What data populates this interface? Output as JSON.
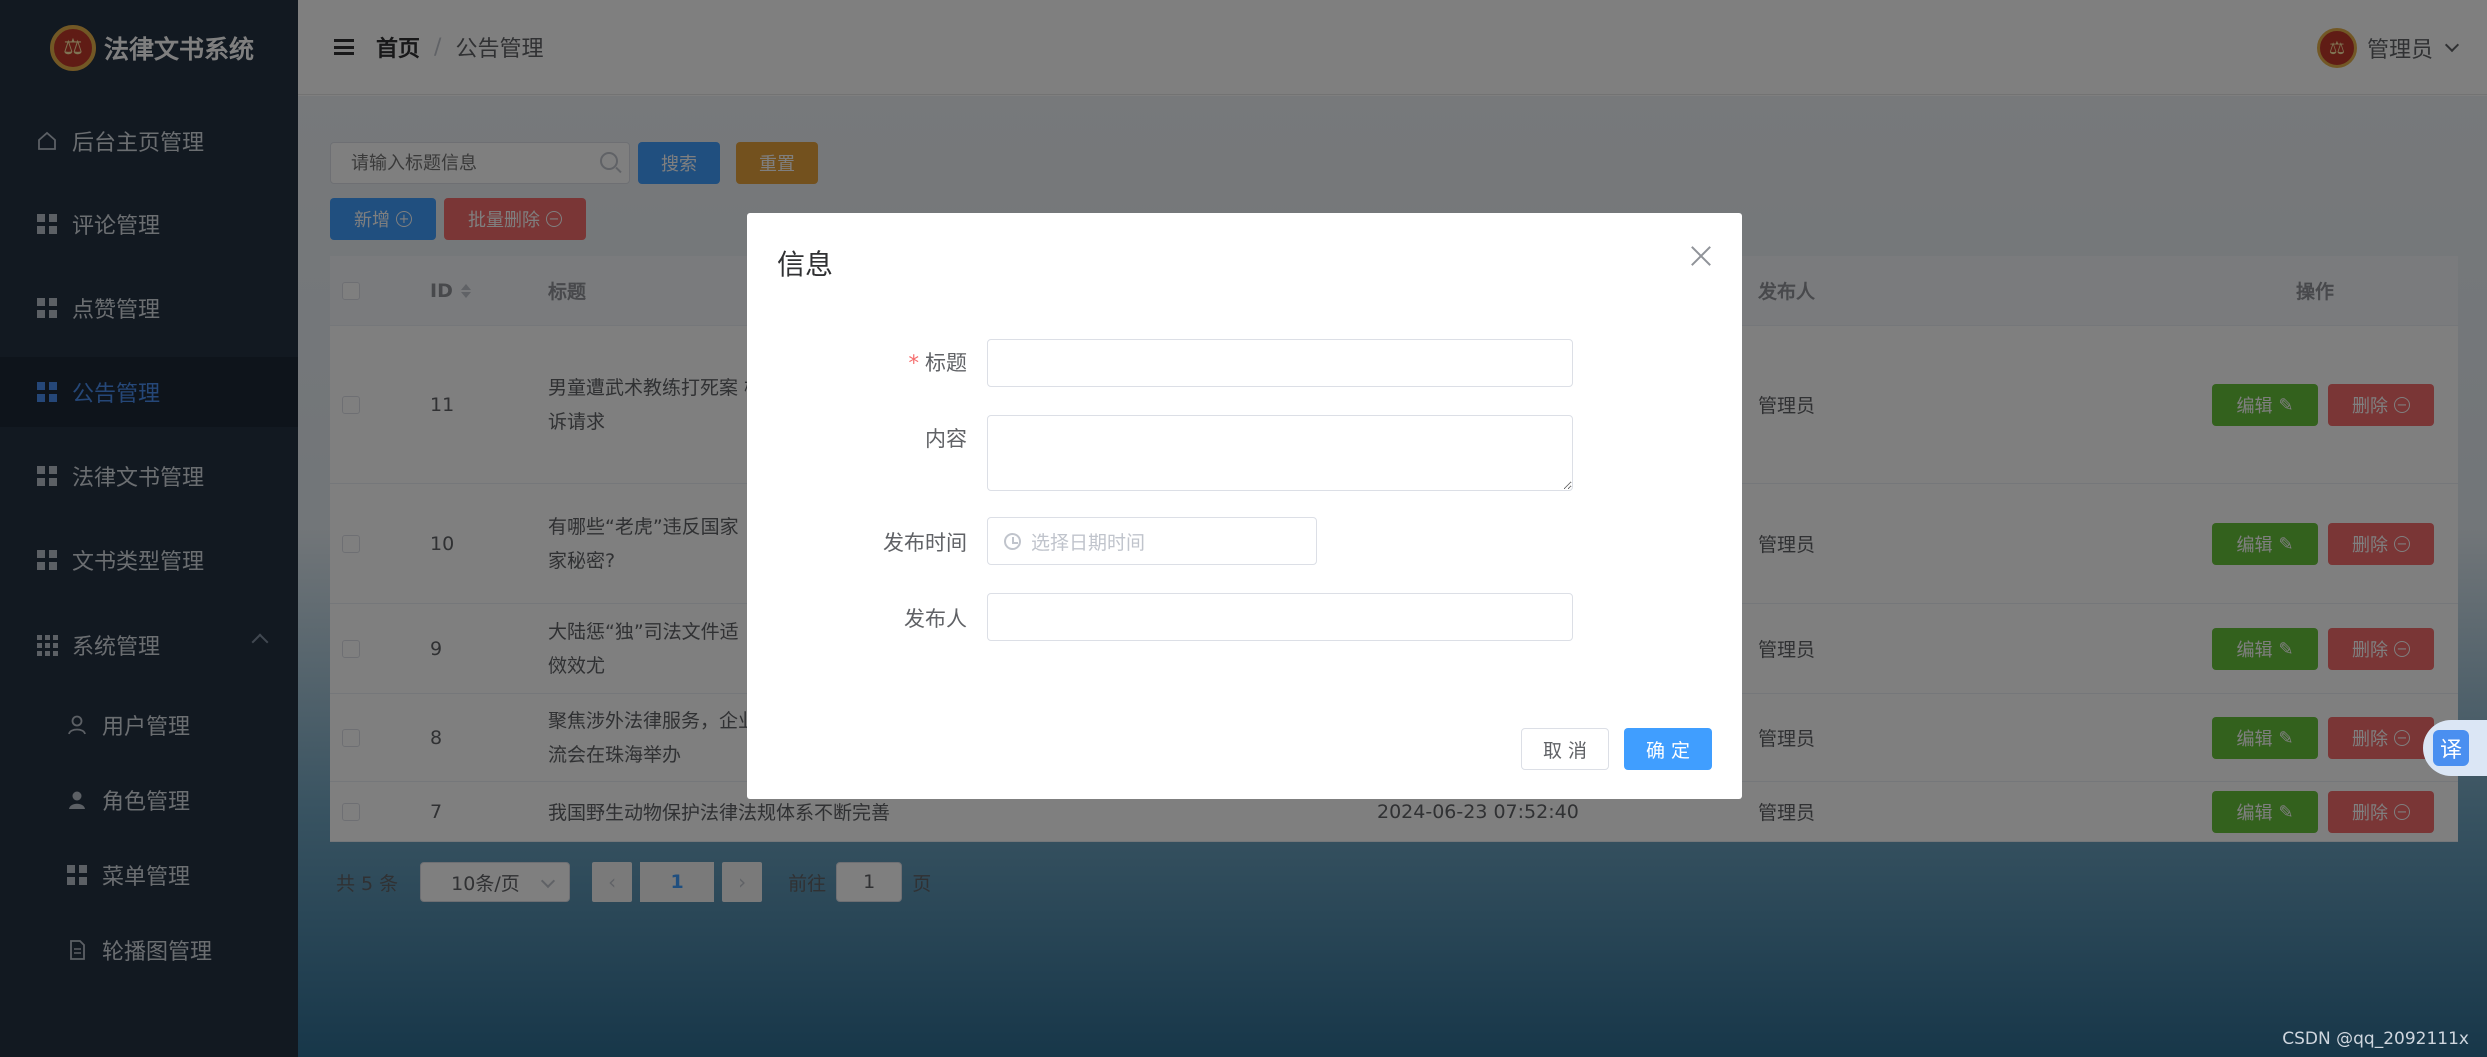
{
  "app": {
    "title": "法律文书系统"
  },
  "sidebar": {
    "items": [
      {
        "label": "后台主页管理",
        "icon": "home-icon"
      },
      {
        "label": "评论管理",
        "icon": "grid-icon"
      },
      {
        "label": "点赞管理",
        "icon": "grid-icon"
      },
      {
        "label": "公告管理",
        "icon": "grid-icon",
        "active": true
      },
      {
        "label": "法律文书管理",
        "icon": "grid-icon"
      },
      {
        "label": "文书类型管理",
        "icon": "grid-icon"
      },
      {
        "label": "系统管理",
        "icon": "apps-icon",
        "expanded": true
      }
    ],
    "sub_items": [
      {
        "label": "用户管理",
        "icon": "user-outline-icon"
      },
      {
        "label": "角色管理",
        "icon": "user-icon"
      },
      {
        "label": "菜单管理",
        "icon": "grid-icon"
      },
      {
        "label": "轮播图管理",
        "icon": "document-icon"
      }
    ]
  },
  "header": {
    "breadcrumb_home": "首页",
    "breadcrumb_sep": "/",
    "breadcrumb_current": "公告管理",
    "user": "管理员"
  },
  "toolbar": {
    "search_placeholder": "请输入标题信息",
    "search_label": "搜索",
    "reset_label": "重置",
    "add_label": "新增",
    "batch_delete_label": "批量删除"
  },
  "table": {
    "headers": {
      "id": "ID",
      "title": "标题",
      "publisher": "发布人",
      "operation": "操作"
    },
    "rows": [
      {
        "id": "11",
        "title_l1": "男童遭武术教练打死案 检",
        "title_l2": "诉请求",
        "time": "",
        "publisher": "管理员"
      },
      {
        "id": "10",
        "title_l1": "有哪些“老虎”违反国家",
        "title_l2": "家秘密?",
        "time": "",
        "publisher": "管理员"
      },
      {
        "id": "9",
        "title_l1": "大陆惩“独”司法文件适",
        "title_l2": "傚效尤",
        "time": "",
        "publisher": "管理员"
      },
      {
        "id": "8",
        "title_l1": "聚焦涉外法律服务，企业",
        "title_l2": "流会在珠海举办",
        "time": "",
        "publisher": "管理员"
      },
      {
        "id": "7",
        "title_l1": "我国野生动物保护法律法规体系不断完善",
        "title_l2": "",
        "time": "2024-06-23 07:52:40",
        "publisher": "管理员"
      }
    ],
    "edit_label": "编辑",
    "delete_label": "删除"
  },
  "pagination": {
    "total": "共 5 条",
    "page_size": "10条/页",
    "current": "1",
    "goto_prefix": "前往",
    "goto_value": "1",
    "goto_suffix": "页"
  },
  "dialog": {
    "title": "信息",
    "required_mark": "*",
    "fields": {
      "title_label": "标题",
      "content_label": "内容",
      "time_label": "发布时间",
      "time_placeholder": "选择日期时间",
      "publisher_label": "发布人"
    },
    "cancel_label": "取 消",
    "ok_label": "确 定"
  },
  "translate_badge": "译",
  "watermark": "CSDN @qq_2092111x",
  "colors": {
    "sidebar_bg": "#243243",
    "primary": "#409eff",
    "success": "#67c23a",
    "danger": "#f56c6c",
    "warning": "#e6a23c"
  }
}
